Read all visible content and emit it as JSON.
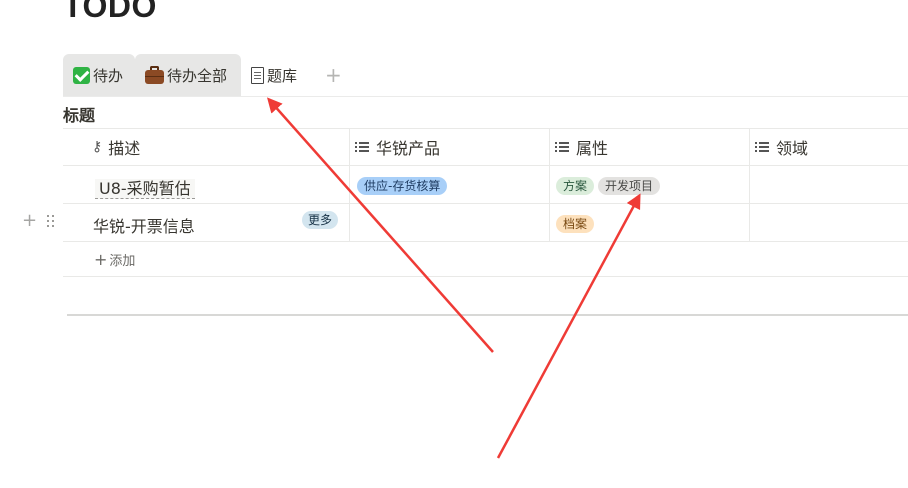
{
  "page": {
    "title": "TODO"
  },
  "tabs": [
    {
      "label": "待办",
      "icon": "check-icon"
    },
    {
      "label": "待办全部",
      "icon": "briefcase-icon"
    },
    {
      "label": "题库",
      "icon": "document-icon"
    }
  ],
  "section": {
    "title": "标题"
  },
  "table": {
    "columns": [
      {
        "label": "描述",
        "icon": "key-icon"
      },
      {
        "label": "华锐产品",
        "icon": "list-icon"
      },
      {
        "label": "属性",
        "icon": "list-icon"
      },
      {
        "label": "领域",
        "icon": "list-icon"
      }
    ],
    "rows": [
      {
        "title": "U8-采购暂估",
        "product": [
          "供应-存货核算"
        ],
        "attributes": [
          "方案",
          "开发项目"
        ]
      },
      {
        "title": "华锐-开票信息",
        "more_label": "更多",
        "product": [],
        "attributes": [
          "档案"
        ]
      }
    ],
    "add_label": "添加"
  },
  "colors": {
    "annotation_arrow": "#ef3b36",
    "pill_blue": "#a8cff8",
    "pill_green": "#dbeddb",
    "pill_grey": "#e3e2e0",
    "pill_orange": "#fde1bd"
  }
}
